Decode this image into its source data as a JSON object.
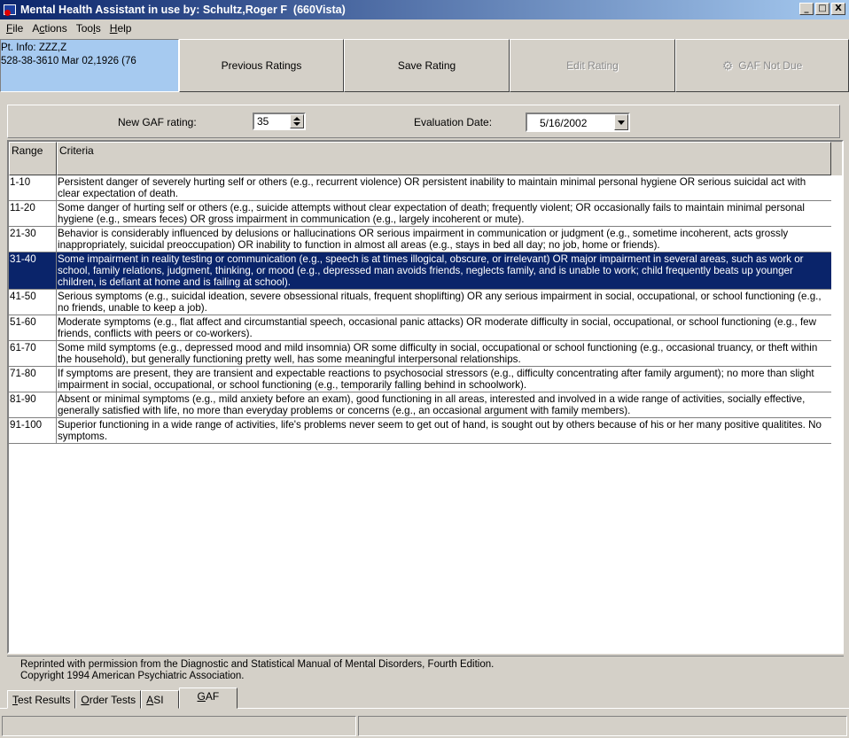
{
  "window": {
    "title": "Mental Health Assistant in use by: Schultz,Roger F  (660Vista)",
    "controls": [
      "_",
      "□",
      "X"
    ]
  },
  "menu": [
    {
      "label": "File",
      "accel": "F",
      "rest": "ile"
    },
    {
      "label": "Actions",
      "pre": "A",
      "accel": "c",
      "rest": "tions"
    },
    {
      "label": "Tools",
      "pre": "Too",
      "accel": "l",
      "rest": "s"
    },
    {
      "label": "Help",
      "accel": "H",
      "rest": "elp"
    }
  ],
  "toolbar": {
    "pt_info_line1": "Pt. Info: ZZZ,Z",
    "pt_info_line2": "528-38-3610   Mar 02,1926 (76",
    "previous_ratings": "Previous Ratings",
    "save_rating": "Save Rating",
    "edit_rating": "Edit Rating",
    "gaf_not_due": "GAF Not Due"
  },
  "gaf": {
    "new_rating_label": "New GAF rating:",
    "new_rating_value": "35",
    "eval_date_label": "Evaluation Date:",
    "eval_date_value": "5/16/2002"
  },
  "grid": {
    "columns": [
      "Range",
      "Criteria"
    ],
    "rows": [
      {
        "range": "1-10",
        "criteria": "Persistent danger of severely hurting self or others (e.g., recurrent violence) OR persistent inability to maintain minimal personal hygiene OR serious suicidal act with clear expectation of death."
      },
      {
        "range": "11-20",
        "criteria": "Some danger of hurting self or others (e.g., suicide attempts without clear expectation of death; frequently violent; OR occasionally fails to maintain minimal personal hygiene (e.g., smears feces) OR gross impairment in communication (e.g., largely incoherent or mute)."
      },
      {
        "range": "21-30",
        "criteria": "Behavior is considerably influenced by delusions or hallucinations OR serious impairment in communication or judgment (e.g., sometime incoherent, acts grossly inappropriately, suicidal preoccupation) OR inability to function in almost all areas (e.g., stays in bed all day; no job, home or friends)."
      },
      {
        "range": "31-40",
        "criteria": "Some impairment in reality testing or communication (e.g., speech is at times illogical, obscure, or irrelevant) OR major impairment in several areas, such as work or school, family relations, judgment, thinking, or mood (e.g., depressed man avoids friends, neglects family, and is unable to work; child frequently beats up younger children, is defiant at home and is failing at school).",
        "selected": true
      },
      {
        "range": "41-50",
        "criteria": "Serious symptoms (e.g., suicidal ideation, severe obsessional rituals, frequent shoplifting) OR any serious impairment in social, occupational, or school functioning (e.g., no friends, unable to keep a job)."
      },
      {
        "range": "51-60",
        "criteria": "Moderate symptoms (e.g., flat affect and circumstantial speech, occasional panic attacks) OR moderate difficulty in social, occupational, or school functioning (e.g., few friends, conflicts with peers or co-workers)."
      },
      {
        "range": "61-70",
        "criteria": "Some mild symptoms (e.g., depressed mood and mild insomnia) OR some difficulty in social, occupational or school functioning (e.g., occasional truancy, or theft within the household), but generally functioning pretty well, has some meaningful interpersonal relationships."
      },
      {
        "range": "71-80",
        "criteria": "If symptoms are present, they are transient and expectable reactions to psychosocial stressors (e.g., difficulty concentrating after family argument); no more than slight impairment in social, occupational, or school functioning (e.g., temporarily falling behind in schoolwork)."
      },
      {
        "range": "81-90",
        "criteria": "Absent or minimal symptoms (e.g., mild anxiety before an exam), good functioning in all areas, interested and involved in a wide range of activities, socially effective, generally satisfied with life, no more than everyday problems or concerns (e.g., an occasional argument with family members)."
      },
      {
        "range": "91-100",
        "criteria": "Superior functioning in a wide range of activities, life's problems never seem to get out of hand, is sought out by others because of his or her many positive qualitites.  No symptoms."
      }
    ]
  },
  "footer": {
    "line1": "Reprinted with permission from the Diagnostic and Statistical Manual of Mental Disorders, Fourth Edition.",
    "line2": "Copyright 1994 American Psychiatric Association."
  },
  "tabs": [
    {
      "label": "Test Results",
      "accel": "T",
      "rest": "est Results"
    },
    {
      "label": "Order Tests",
      "accel": "O",
      "rest": "rder Tests"
    },
    {
      "label": "ASI",
      "accel": "A",
      "rest": "SI"
    },
    {
      "label": "GAF",
      "accel": "G",
      "rest": "AF",
      "active": true
    }
  ],
  "icons": {
    "app": "mha-app-icon",
    "gaf_not_due": "gear-icon"
  },
  "colors": {
    "selection": "#0a246a",
    "pt_info_bg": "#a6caf0",
    "face": "#d4d0c8"
  }
}
